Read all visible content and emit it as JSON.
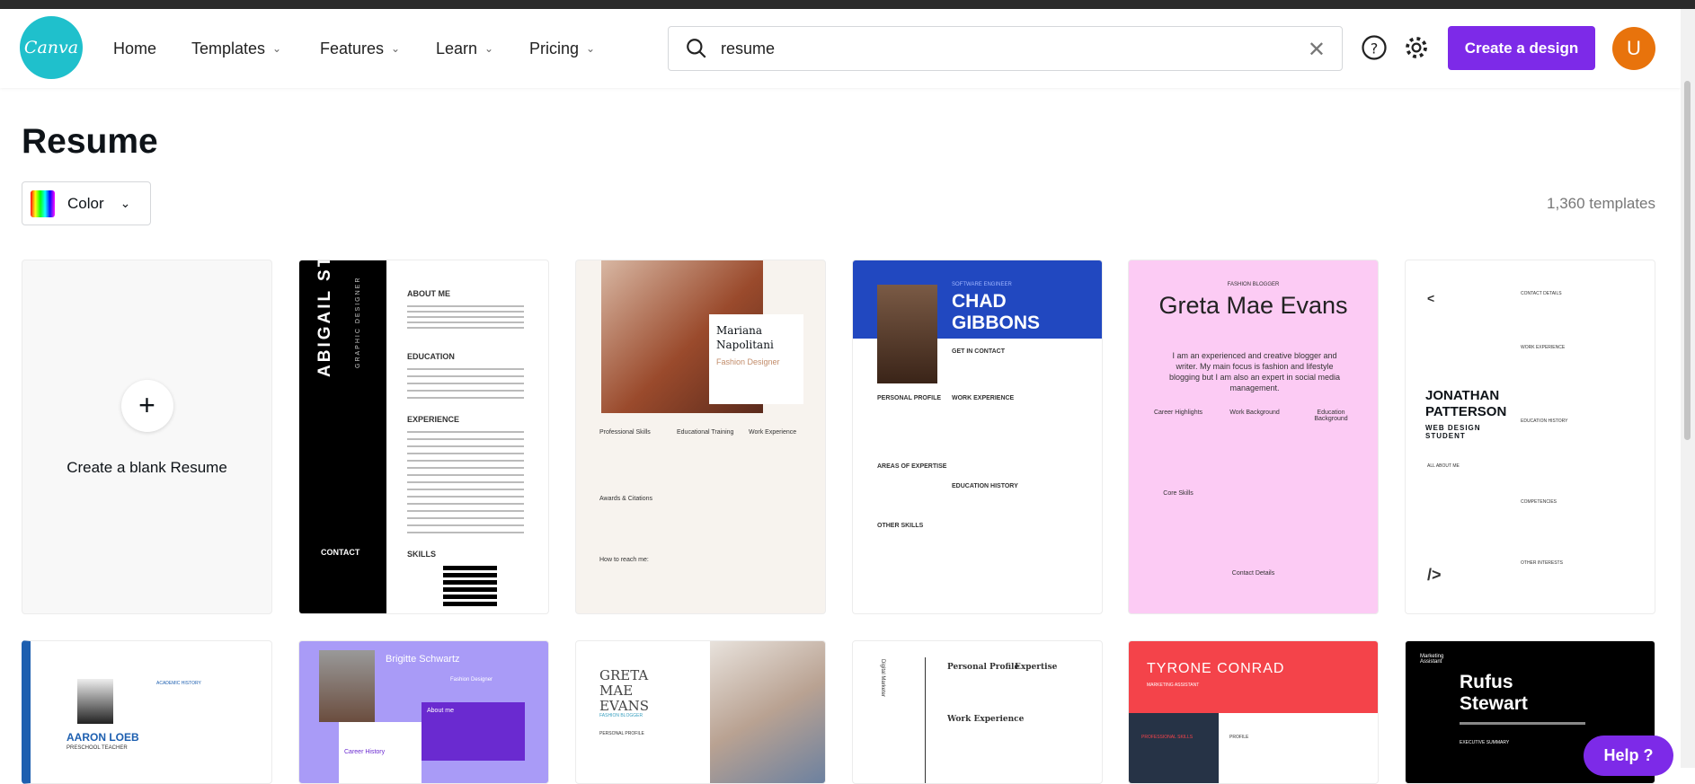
{
  "header": {
    "logo": "Canva",
    "nav": [
      {
        "label": "Home",
        "dropdown": false
      },
      {
        "label": "Templates",
        "dropdown": true
      },
      {
        "label": "Features",
        "dropdown": true
      },
      {
        "label": "Learn",
        "dropdown": true
      },
      {
        "label": "Pricing",
        "dropdown": true
      }
    ],
    "search_value": "resume",
    "create_label": "Create a design",
    "avatar_initial": "U"
  },
  "page": {
    "title": "Resume",
    "color_filter": "Color",
    "count": "1,360 templates",
    "blank_label": "Create a blank Resume",
    "help_label": "Help ?"
  },
  "templates": [
    {
      "name": "ABIGAIL STANFORD",
      "subtitle": "GRAPHIC DESIGNER",
      "sections": [
        "ABOUT ME",
        "EDUCATION",
        "EXPERIENCE",
        "SKILLS"
      ],
      "side": "CONTACT"
    },
    {
      "name": "Mariana Napolitani",
      "subtitle": "Fashion Designer",
      "sections": [
        "Professional Skills",
        "Educational Training",
        "Work Experience",
        "Awards & Citations",
        "How to reach me:"
      ]
    },
    {
      "name": "CHAD GIBBONS",
      "subtitle": "SOFTWARE ENGINEER",
      "sections": [
        "GET IN CONTACT",
        "PERSONAL PROFILE",
        "WORK EXPERIENCE",
        "AREAS OF EXPERTISE",
        "EDUCATION HISTORY",
        "OTHER SKILLS"
      ]
    },
    {
      "name": "Greta Mae Evans",
      "subtitle": "FASHION BLOGGER",
      "summary": "I am an experienced and creative blogger and writer. My main focus is fashion and lifestyle blogging but I am also an expert in social media management.",
      "sections": [
        "Career Highlights",
        "Work Background",
        "Education Background",
        "Core Skills",
        "Contact Details"
      ]
    },
    {
      "name": "JONATHAN PATTERSON",
      "subtitle": "WEB DESIGN STUDENT",
      "sections": [
        "CONTACT DETAILS",
        "WORK EXPERIENCE",
        "EDUCATION HISTORY",
        "ALL ABOUT ME",
        "COMPETENCIES",
        "OTHER INTERESTS"
      ]
    },
    {
      "name": "AARON LOEB",
      "subtitle": "PRESCHOOL TEACHER",
      "sections": [
        "ACADEMIC HISTORY"
      ]
    },
    {
      "name": "Brigitte Schwartz",
      "subtitle": "Fashion Designer",
      "sections": [
        "About me",
        "Career History"
      ]
    },
    {
      "name": "GRETA MAE EVANS",
      "subtitle": "FASHION BLOGGER",
      "sections": [
        "PERSONAL PROFILE"
      ]
    },
    {
      "name": "Digital Marketer",
      "subtitle": "",
      "sections": [
        "Personal Profile",
        "Expertise",
        "Work Experience"
      ]
    },
    {
      "name": "TYRONE CONRAD",
      "subtitle": "MARKETING ASSISTANT",
      "sections": [
        "PROFESSIONAL SKILLS",
        "PROFILE"
      ]
    },
    {
      "name": "Rufus Stewart",
      "subtitle": "Marketing Assistant",
      "sections": [
        "EXECUTIVE SUMMARY"
      ]
    }
  ],
  "colors": {
    "brand": "#7d2ae8",
    "logo": "#1fc0cc",
    "avatar": "#e8730c"
  }
}
